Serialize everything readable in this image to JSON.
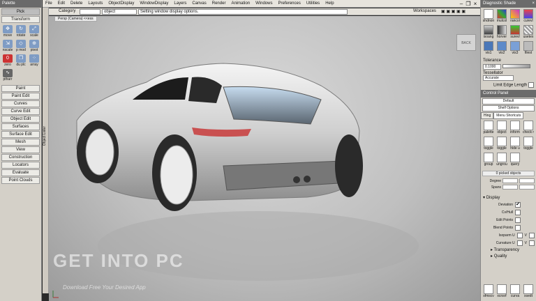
{
  "palette": {
    "title": "Palette",
    "buttons_top": [
      "Pick",
      "Transform"
    ],
    "tools": [
      {
        "label": "move",
        "icon": "move-icon"
      },
      {
        "label": "rotate",
        "icon": "rotate-icon"
      },
      {
        "label": "scale",
        "icon": "scale-icon"
      },
      {
        "label": "nscale",
        "icon": "nscale-icon"
      },
      {
        "label": "p mod",
        "icon": "pmod-icon"
      },
      {
        "label": "pivot",
        "icon": "pivot-icon"
      },
      {
        "label": "zero",
        "icon": "zero-icon"
      },
      {
        "label": "du plc",
        "icon": "duplicate-icon"
      },
      {
        "label": "array",
        "icon": "array-icon"
      },
      {
        "label": "ptharr",
        "icon": "path-array-icon"
      }
    ],
    "categories": [
      "Paint",
      "Paint Edit",
      "Curves",
      "Curve Edit",
      "Object Edit",
      "Surfaces",
      "Surface Edit",
      "Mesh",
      "View",
      "Construction",
      "Locators",
      "Evaluate",
      "Point Clouds"
    ]
  },
  "sidestrip_label": "Object Lister",
  "menubar": {
    "items": [
      "File",
      "Edit",
      "Delete",
      "Layouts",
      "ObjectDisplay",
      "WindowDisplay",
      "Layers",
      "Canvas",
      "Render",
      "Animation",
      "Windows",
      "Preferences",
      "Utilities",
      "Help"
    ]
  },
  "infobar": {
    "category_label": "Category",
    "category_value": "",
    "object_label": "object",
    "status": "Setting window display options.",
    "workspaces": "Workspaces"
  },
  "viewport": {
    "tab": "Persp (Camera) <<ess",
    "back_label": "BACK",
    "watermark": "GET INTO PC",
    "watermark_sub": "Download Free Your Desired App"
  },
  "diagnostic": {
    "title": "Diagnostic Shade",
    "tools": [
      {
        "label": "shdnon",
        "icon": "shade-none-icon"
      },
      {
        "label": "mulcol",
        "icon": "multicolor-icon"
      },
      {
        "label": "rancol",
        "icon": "random-color-icon"
      },
      {
        "label": "curevl",
        "icon": "curvature-eval-icon"
      },
      {
        "label": "isoang",
        "icon": "isoangle-icon"
      },
      {
        "label": "horver",
        "icon": "horizontal-vertical-icon"
      },
      {
        "label": "surevl",
        "icon": "surface-eval-icon"
      },
      {
        "label": "usetex",
        "icon": "use-texture-icon"
      },
      {
        "label": "vis1",
        "icon": "visual-1-icon"
      },
      {
        "label": "vis2",
        "icon": "visual-2-icon"
      },
      {
        "label": "vis3",
        "icon": "visual-3-icon"
      },
      {
        "label": "filest",
        "icon": "filestatus-icon"
      }
    ]
  },
  "tolerance": {
    "label": "Tolerance",
    "value": "0.1000",
    "tessellator_label": "Tessellator",
    "tessellator_value": "Accurate",
    "limit_edge_label": "Limit Edge Length"
  },
  "control_panel": {
    "title": "Control Panel",
    "preset": "Default",
    "shelf_options": "Shelf Options",
    "tabs": [
      "Hing",
      "Menu Shortcuts"
    ],
    "tools": [
      {
        "label": "palette",
        "icon": "palette-icon"
      },
      {
        "label": "object",
        "icon": "object-icon"
      },
      {
        "label": "inform",
        "icon": "info-icon"
      },
      {
        "label": "check r",
        "icon": "check-icon"
      },
      {
        "label": "toggle",
        "icon": "toggle-icon"
      },
      {
        "label": "toggle",
        "icon": "toggle-2-icon"
      },
      {
        "label": "hide u",
        "icon": "hide-icon"
      },
      {
        "label": "toggle",
        "icon": "toggle-3-icon"
      },
      {
        "label": "group",
        "icon": "group-icon"
      },
      {
        "label": "ungrou",
        "icon": "ungroup-icon"
      },
      {
        "label": "query",
        "icon": "query-icon"
      }
    ],
    "picked_objects": "0 picked objects",
    "degree_label": "Degree",
    "spans_label": "Spans",
    "display_label": "Display",
    "display_rows": [
      {
        "label": "Deviation",
        "checked": true,
        "v": false
      },
      {
        "label": "Cv/Hull",
        "checked": false,
        "v": false
      },
      {
        "label": "Edit Points",
        "checked": false,
        "v": false
      },
      {
        "label": "Blend Points",
        "checked": false,
        "v": false
      },
      {
        "label": "Isoparm U",
        "checked": false,
        "v": true
      },
      {
        "label": "Curvature U",
        "checked": false,
        "v": true
      }
    ],
    "transparency_label": "Transparency",
    "quality_label": "Quality",
    "bottom_tools": [
      {
        "label": "sfmscv",
        "icon": "sfmscv-icon"
      },
      {
        "label": "xcnsrf",
        "icon": "xcnsrf-icon"
      },
      {
        "label": "curva",
        "icon": "curvature-icon"
      },
      {
        "label": "xsedt",
        "icon": "xsedit-icon"
      }
    ]
  }
}
